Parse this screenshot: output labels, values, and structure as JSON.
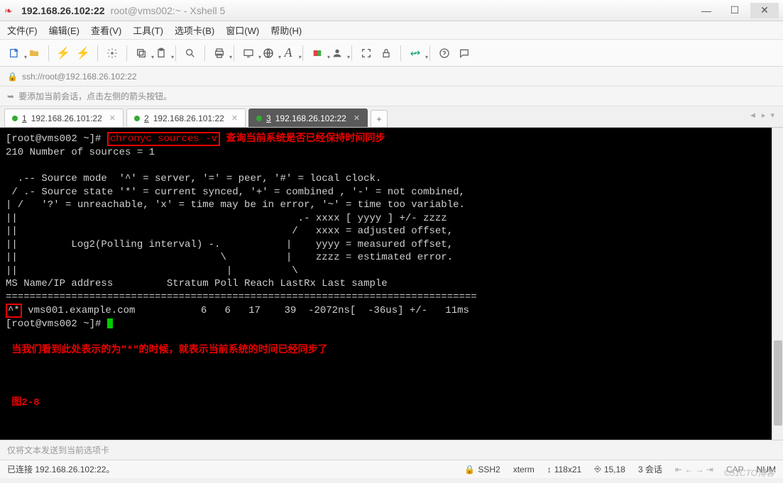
{
  "title": {
    "main": "192.168.26.102:22",
    "sub": "root@vms002:~ - Xshell 5"
  },
  "menu": {
    "file": "文件(F)",
    "edit": "编辑(E)",
    "view": "查看(V)",
    "tools": "工具(T)",
    "tabs": "选项卡(B)",
    "window": "窗口(W)",
    "help": "帮助(H)"
  },
  "addressbar": {
    "url": "ssh://root@192.168.26.102:22"
  },
  "hintbar": {
    "text": "要添加当前会话，点击左侧的箭头按钮。"
  },
  "tabs": [
    {
      "num": "1",
      "label": "192.168.26.101:22",
      "active": false
    },
    {
      "num": "2",
      "label": "192.168.26.101:22",
      "active": false
    },
    {
      "num": "3",
      "label": "192.168.26.102:22",
      "active": true
    }
  ],
  "terminal": {
    "prompt1_a": "[root@vms002 ~]# ",
    "cmd": "chronyc sources -v",
    "ann1": " 查询当前系统是否已经保持时间同步",
    "line_sources": "210 Number of sources = 1",
    "body1": "  .-- Source mode  '^' = server, '=' = peer, '#' = local clock.",
    "body2": " / .- Source state '*' = current synced, '+' = combined , '-' = not combined,",
    "body3": "| /   '?' = unreachable, 'x' = time may be in error, '~' = time too variable.",
    "body4": "||                                               .- xxxx [ yyyy ] +/- zzzz",
    "body5": "||                                              /   xxxx = adjusted offset,",
    "body6": "||         Log2(Polling interval) -.           |    yyyy = measured offset,",
    "body7": "||                                  \\          |    zzzz = estimated error.",
    "body8": "||                                   |          \\",
    "header": "MS Name/IP address         Stratum Poll Reach LastRx Last sample",
    "divider": "===============================================================================",
    "star": "^*",
    "dataline": " vms001.example.com           6   6   17    39  -2072ns[  -36us] +/-   11ms",
    "prompt2": "[root@vms002 ~]# ",
    "ann2": "当我们看到此处表示的为\"*\"的时候，就表示当前系统的时间已经同步了",
    "figlabel": "图2-8"
  },
  "inputbar": {
    "placeholder": "仅将文本发送到当前选项卡"
  },
  "statusbar": {
    "conn": "已连接 192.168.26.102:22。",
    "proto": "SSH2",
    "term": "xterm",
    "size": "118x21",
    "pos": "15,18",
    "sessions": "3 会话",
    "cap": "CAP",
    "num": "NUM"
  },
  "watermark": "©51CTO博客"
}
